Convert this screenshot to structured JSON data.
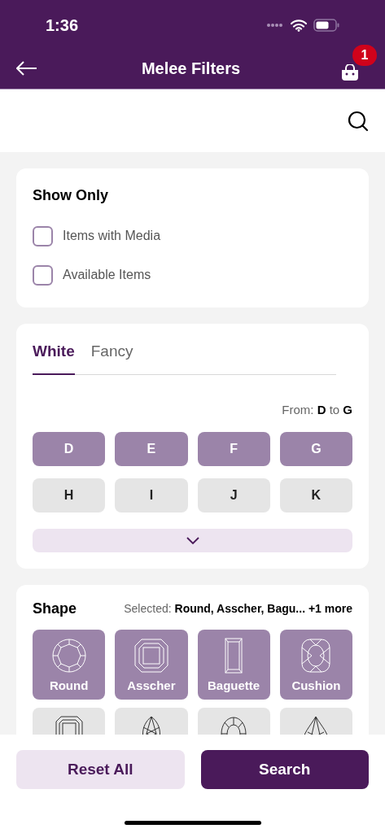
{
  "status_bar": {
    "time": "1:36"
  },
  "header": {
    "title": "Melee Filters",
    "cart_count": "1"
  },
  "show_only": {
    "title": "Show Only",
    "options": [
      {
        "label": "Items with Media",
        "checked": false
      },
      {
        "label": "Available Items",
        "checked": false
      }
    ]
  },
  "color": {
    "tabs": [
      {
        "label": "White",
        "selected": true
      },
      {
        "label": "Fancy",
        "selected": false
      }
    ],
    "range": "From: **D** to **G**",
    "grades": [
      {
        "label": "D",
        "selected": true
      },
      {
        "label": "E",
        "selected": true
      },
      {
        "label": "F",
        "selected": true
      },
      {
        "label": "G",
        "selected": true
      },
      {
        "label": "H",
        "selected": false
      },
      {
        "label": "I",
        "selected": false
      },
      {
        "label": "J",
        "selected": false
      },
      {
        "label": "K",
        "selected": false
      }
    ]
  },
  "shape": {
    "title": "Shape",
    "selected_summary": "Selected: **Round, Asscher, Bagu...  +1 more**",
    "items": [
      {
        "kind": "round",
        "label": "Round",
        "selected": true
      },
      {
        "kind": "asscher",
        "label": "Asscher",
        "selected": true
      },
      {
        "kind": "baguette",
        "label": "Baguette",
        "selected": true
      },
      {
        "kind": "cushion",
        "label": "Cushion",
        "selected": true
      },
      {
        "kind": "emerald",
        "selected": false
      },
      {
        "kind": "marquise",
        "selected": false
      },
      {
        "kind": "oval",
        "selected": false
      },
      {
        "kind": "pear",
        "selected": false
      }
    ]
  },
  "actions": [
    {
      "label": "Reset All",
      "kind": "secondary"
    },
    {
      "label": "Search",
      "kind": "primary"
    }
  ]
}
